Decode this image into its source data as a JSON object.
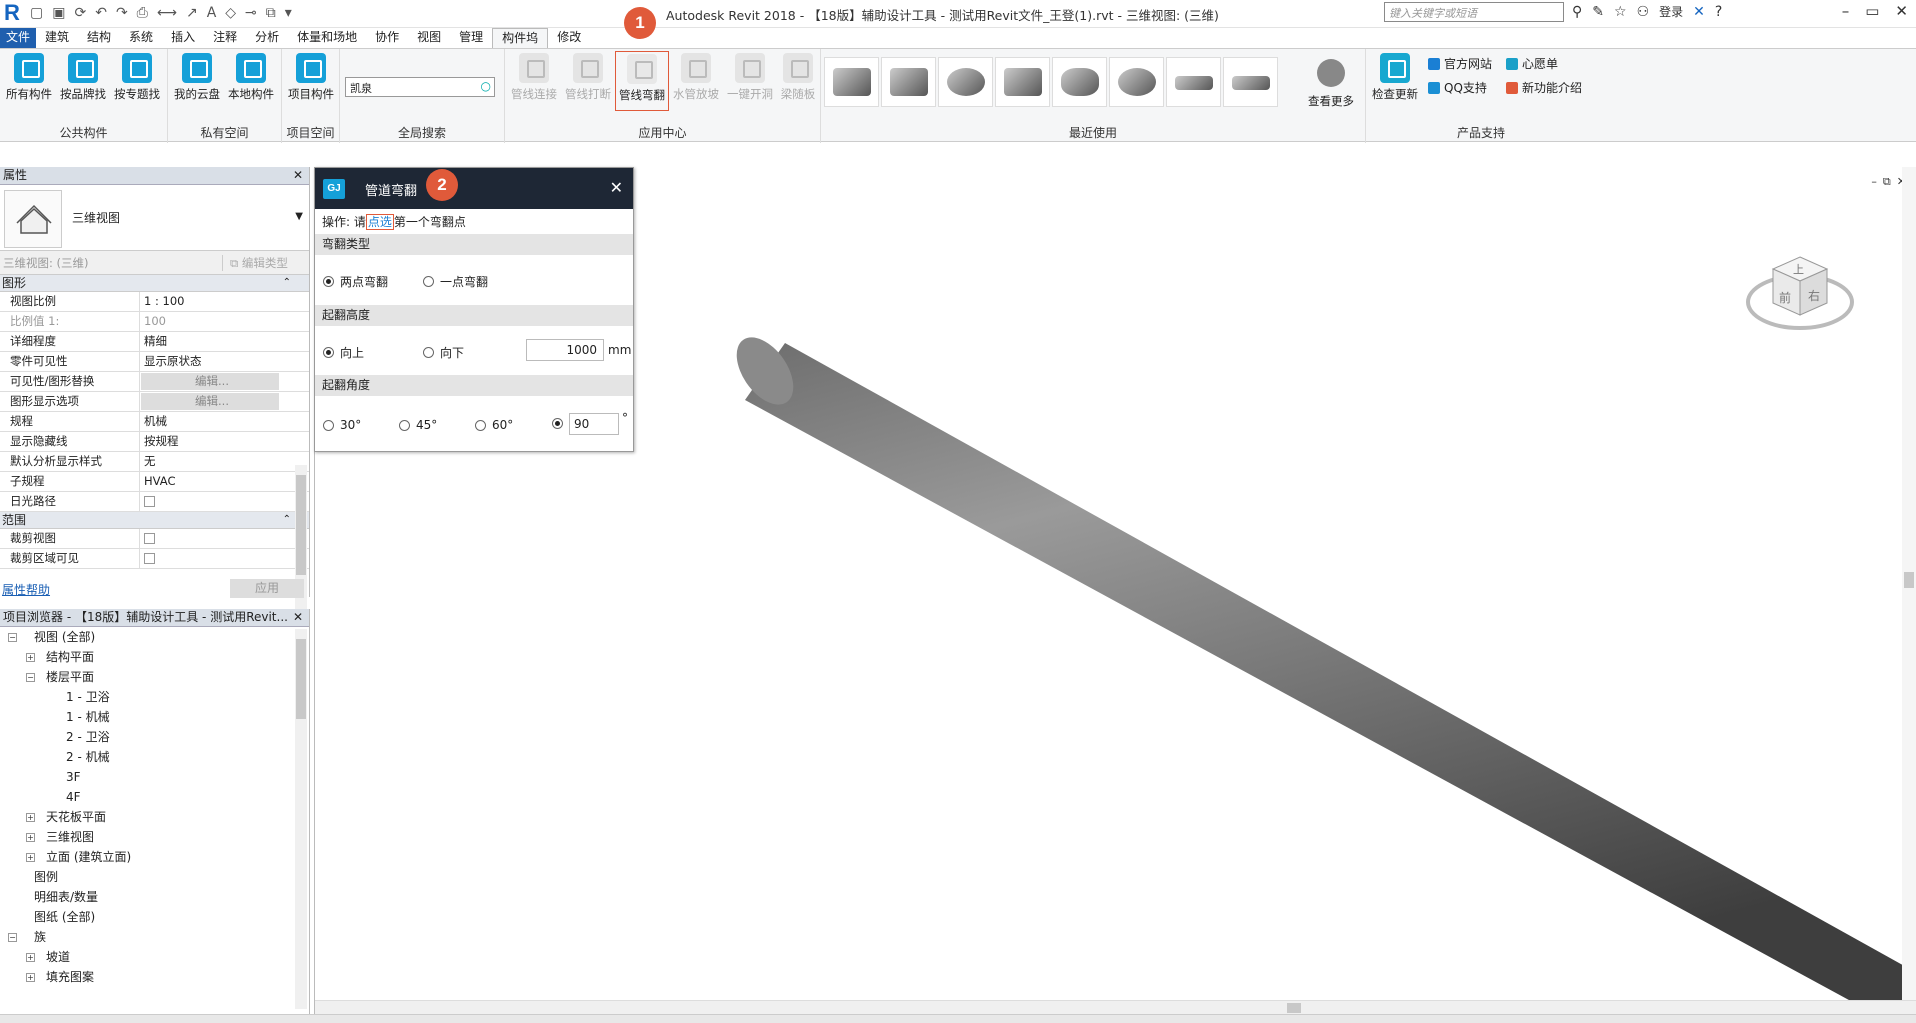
{
  "window": {
    "title": "Autodesk Revit 2018 -    【18版】辅助设计工具 - 测试用Revit文件_王登(1).rvt - 三维视图: (三维)",
    "search_placeholder": "键入关键字或短语",
    "login": "登录"
  },
  "tabs": [
    "文件",
    "建筑",
    "结构",
    "系统",
    "插入",
    "注释",
    "分析",
    "体量和场地",
    "协作",
    "视图",
    "管理",
    "构件坞",
    "修改"
  ],
  "active_tab": "构件坞",
  "ribbon": {
    "public": {
      "label": "公共构件",
      "buttons": [
        "所有构件",
        "按品牌找",
        "按专题找"
      ]
    },
    "private": {
      "label": "私有空间",
      "buttons": [
        "我的云盘",
        "本地构件"
      ]
    },
    "project": {
      "label": "项目空间",
      "buttons": [
        "项目构件"
      ]
    },
    "search": {
      "label": "全局搜索",
      "value": "凯泉"
    },
    "app": {
      "label": "应用中心",
      "buttons": [
        "管线连接",
        "管线打断",
        "管线弯翻",
        "水管放坡",
        "一键开洞",
        "梁随板"
      ]
    },
    "recent": {
      "label": "最近使用",
      "more": "查看更多"
    },
    "support": {
      "label": "产品支持",
      "links": [
        "检查更新",
        "官方网站",
        "心愿单",
        "QQ支持",
        "新功能介绍"
      ]
    }
  },
  "badges": [
    "1",
    "2"
  ],
  "properties": {
    "title": "属性",
    "type_name": "三维视图",
    "selector": "三维视图: (三维)",
    "edit_type": "编辑类型",
    "groups": [
      {
        "name": "图形",
        "rows": [
          {
            "k": "视图比例",
            "v": "1 : 100"
          },
          {
            "k": "比例值 1:",
            "v": "100",
            "grey": true
          },
          {
            "k": "详细程度",
            "v": "精细"
          },
          {
            "k": "零件可见性",
            "v": "显示原状态"
          },
          {
            "k": "可见性/图形替换",
            "v": "编辑...",
            "btn": true
          },
          {
            "k": "图形显示选项",
            "v": "编辑...",
            "btn": true
          },
          {
            "k": "规程",
            "v": "机械"
          },
          {
            "k": "显示隐藏线",
            "v": "按规程"
          },
          {
            "k": "默认分析显示样式",
            "v": "无"
          },
          {
            "k": "子规程",
            "v": "HVAC"
          },
          {
            "k": "日光路径",
            "v": "",
            "cb": true
          }
        ]
      },
      {
        "name": "范围",
        "rows": [
          {
            "k": "裁剪视图",
            "v": "",
            "cb": true
          },
          {
            "k": "裁剪区域可见",
            "v": "",
            "cb": true
          }
        ]
      }
    ],
    "help": "属性帮助",
    "apply": "应用"
  },
  "browser": {
    "title": "项目浏览器 - 【18版】辅助设计工具 - 测试用Revit...",
    "nodes": [
      {
        "t": "视图 (全部)",
        "lvl": 0,
        "pm": "-"
      },
      {
        "t": "结构平面",
        "lvl": 1,
        "pm": "+"
      },
      {
        "t": "楼层平面",
        "lvl": 1,
        "pm": "-"
      },
      {
        "t": "1 - 卫浴",
        "lvl": 2
      },
      {
        "t": "1 - 机械",
        "lvl": 2
      },
      {
        "t": "2 - 卫浴",
        "lvl": 2
      },
      {
        "t": "2 - 机械",
        "lvl": 2
      },
      {
        "t": "3F",
        "lvl": 2
      },
      {
        "t": "4F",
        "lvl": 2
      },
      {
        "t": "天花板平面",
        "lvl": 1,
        "pm": "+"
      },
      {
        "t": "三维视图",
        "lvl": 1,
        "pm": "+"
      },
      {
        "t": "立面 (建筑立面)",
        "lvl": 1,
        "pm": "+"
      },
      {
        "t": "图例",
        "lvl": 0
      },
      {
        "t": "明细表/数量",
        "lvl": 0
      },
      {
        "t": "图纸 (全部)",
        "lvl": 0
      },
      {
        "t": "族",
        "lvl": 0,
        "pm": "-"
      },
      {
        "t": "坡道",
        "lvl": 1,
        "pm": "+"
      },
      {
        "t": "填充图案",
        "lvl": 1,
        "pm": "+"
      }
    ]
  },
  "dialog": {
    "title": "管道弯翻",
    "op_prefix": "操作: 请",
    "op_link": "点选",
    "op_suffix": "第一个弯翻点",
    "sec_type": "弯翻类型",
    "type_opts": [
      "两点弯翻",
      "一点弯翻"
    ],
    "sec_height": "起翻高度",
    "height_opts": [
      "向上",
      "向下"
    ],
    "height_value": "1000",
    "height_unit": "mm",
    "sec_angle": "起翻角度",
    "angle_opts": [
      "30°",
      "45°",
      "60°"
    ],
    "angle_value": "90",
    "angle_unit": "°"
  },
  "viewcube": {
    "top": "上",
    "front": "前",
    "right": "右"
  }
}
